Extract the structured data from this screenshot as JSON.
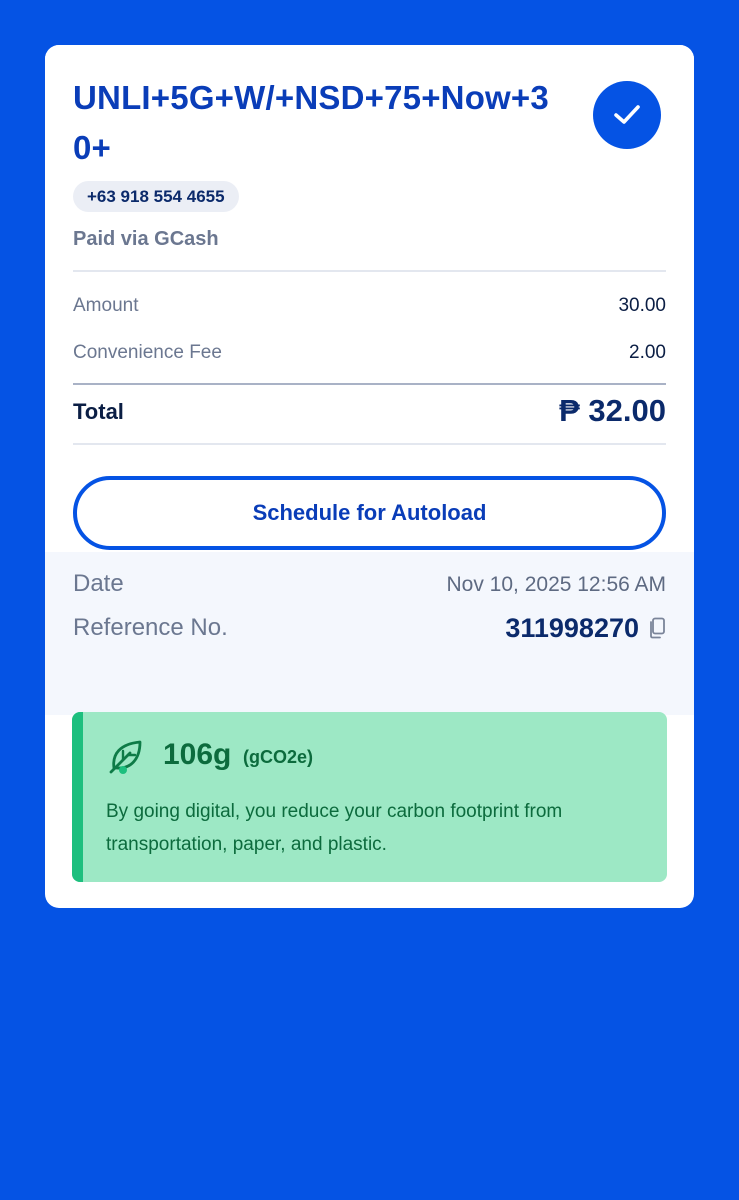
{
  "receipt": {
    "title": "UNLI+5G+W/+NSD+75+Now+30+",
    "phone_number": "+63 918 554 4655",
    "payment_method": "Paid via GCash",
    "amount_label": "Amount",
    "amount_value": "30.00",
    "fee_label": "Convenience Fee",
    "fee_value": "2.00",
    "total_label": "Total",
    "total_value": "₱ 32.00",
    "autoload_button": "Schedule for Autoload",
    "date_label": "Date",
    "date_value": "Nov 10, 2025 12:56 AM",
    "reference_label": "Reference No.",
    "reference_value": "311998270"
  },
  "eco": {
    "amount": "106g",
    "unit": "(gCO2e)",
    "message": "By going digital, you reduce your carbon footprint from transportation, paper, and plastic."
  },
  "icons": {
    "status": "check-circle-icon",
    "copy": "copy-icon",
    "eco": "leaf-icon"
  },
  "colors": {
    "background": "#0553E4",
    "accent": "#0553E4",
    "title": "#0A3DB8",
    "eco_background": "#9DE8C5",
    "eco_bar": "#1DBF7E",
    "eco_text": "#0C6B3D"
  }
}
